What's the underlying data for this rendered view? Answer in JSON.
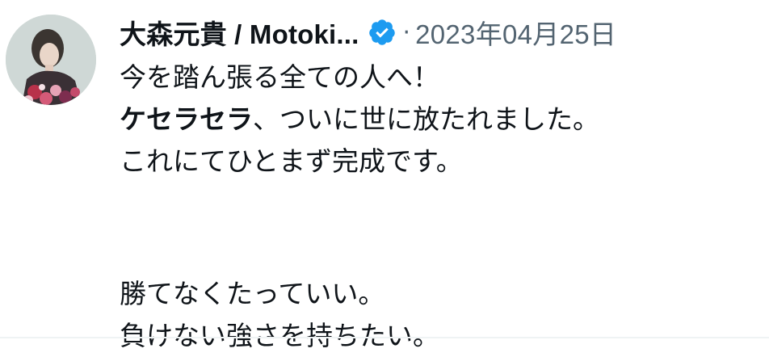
{
  "tweet": {
    "author": {
      "display_name": "大森元貴 / Motoki...",
      "verified": true,
      "avatar_icon": "user-avatar"
    },
    "separator": "·",
    "date": "2023年04月25日",
    "lines": {
      "l1": "今を踏ん張る全ての人へ！",
      "l2_bold": "ケセラセラ",
      "l2_rest": "、ついに世に放たれました。",
      "l3": "これにてひとまず完成です。",
      "l4": "勝てなくたっていい。",
      "l5": "負けない強さを持ちたい。"
    }
  },
  "colors": {
    "text": "#0f1419",
    "secondary": "#536471",
    "verified_badge": "#1d9bf0",
    "divider": "#eff3f4"
  }
}
